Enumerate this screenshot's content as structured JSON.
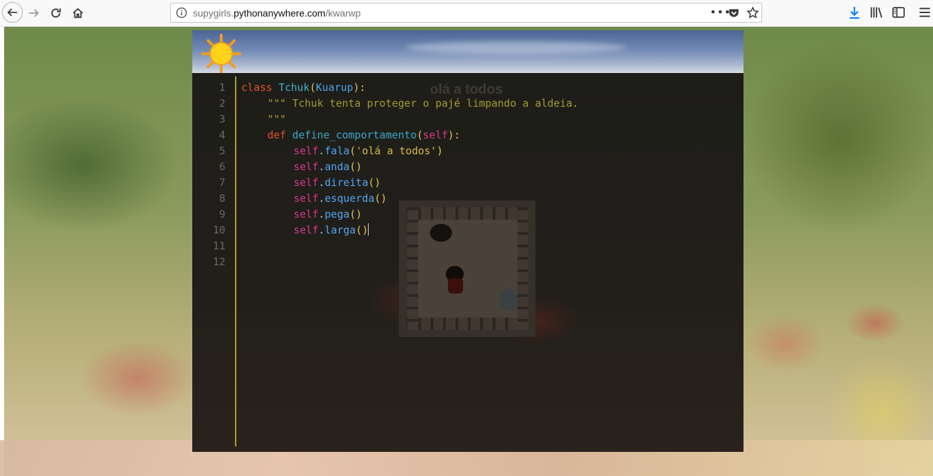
{
  "browser": {
    "url_prefix": "supygirls.",
    "url_host": "pythonanywhere.com",
    "url_path": "/kwarwp",
    "more_label": "•••"
  },
  "game": {
    "title": "olá a todos"
  },
  "editor": {
    "line_numbers": [
      "1",
      "2",
      "3",
      "4",
      "5",
      "6",
      "7",
      "8",
      "9",
      "10",
      "11",
      "12"
    ],
    "lines": {
      "l1": {
        "kw": "class",
        "name": "Tchuk",
        "open": "(",
        "base": "Kuarup",
        "close": "):"
      },
      "l2": {
        "doc": "\"\"\" Tchuk tenta proteger o pajé limpando a aldeia."
      },
      "l3": {
        "doc": "\"\"\""
      },
      "l4": {
        "kw": "def",
        "name": "define_comportamento",
        "open": "(",
        "self": "self",
        "close": "):"
      },
      "l5": {
        "self": "self",
        "dot": ".",
        "method": "fala",
        "open": "(",
        "arg": "'olá a todos'",
        "close": ")"
      },
      "l6": {
        "self": "self",
        "dot": ".",
        "method": "anda",
        "parens": "()"
      },
      "l7": {
        "self": "self",
        "dot": ".",
        "method": "direita",
        "parens": "()"
      },
      "l8": {
        "self": "self",
        "dot": ".",
        "method": "esquerda",
        "parens": "()"
      },
      "l9": {
        "self": "self",
        "dot": ".",
        "method": "pega",
        "parens": "()"
      },
      "l10": {
        "self": "self",
        "dot": ".",
        "method": "larga",
        "parens": "()"
      }
    }
  }
}
